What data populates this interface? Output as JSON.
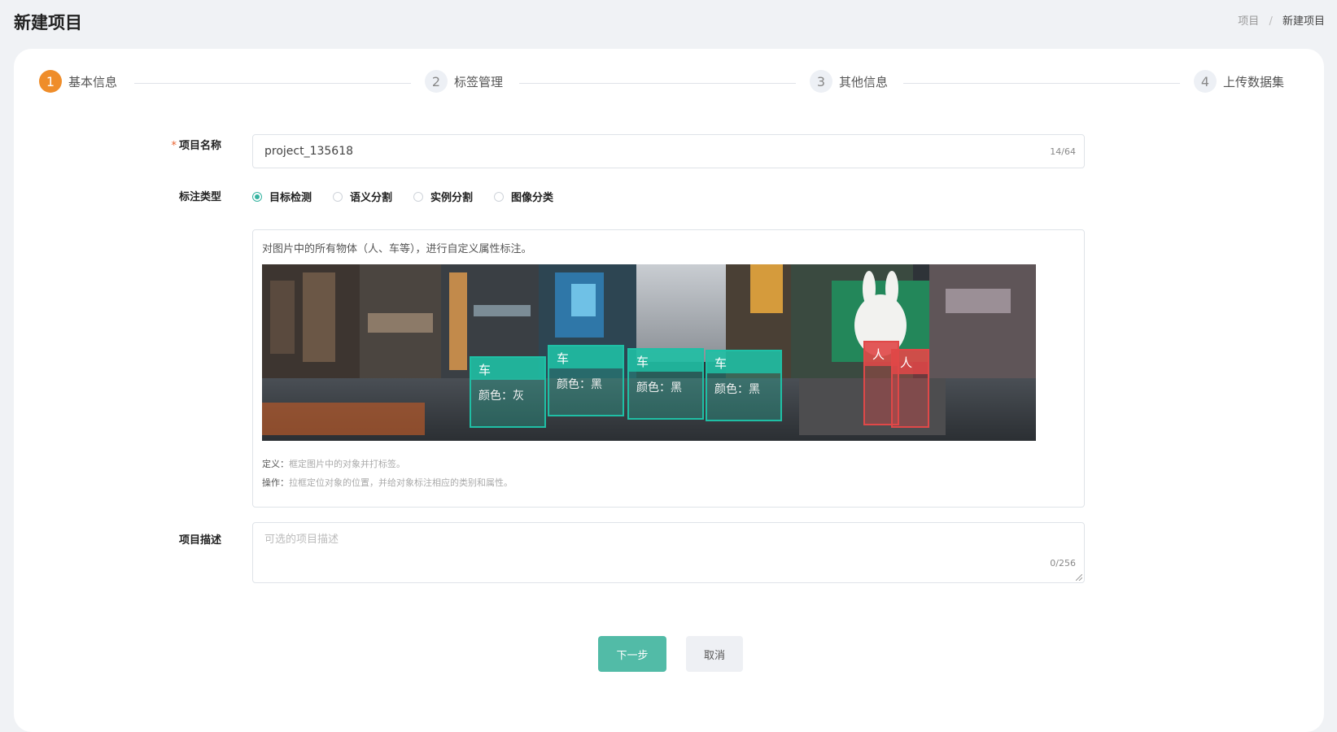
{
  "header": {
    "title": "新建项目",
    "breadcrumb": {
      "parent": "项目",
      "separator": "/",
      "current": "新建项目"
    }
  },
  "steps": [
    {
      "number": "1",
      "label": "基本信息",
      "active": true
    },
    {
      "number": "2",
      "label": "标签管理",
      "active": false
    },
    {
      "number": "3",
      "label": "其他信息",
      "active": false
    },
    {
      "number": "4",
      "label": "上传数据集",
      "active": false
    }
  ],
  "form": {
    "name": {
      "required_mark": "*",
      "label": "项目名称",
      "value": "project_135618",
      "counter": "14/64"
    },
    "annotation_type": {
      "label": "标注类型",
      "options": [
        {
          "label": "目标检测",
          "checked": true
        },
        {
          "label": "语义分割",
          "checked": false
        },
        {
          "label": "实例分割",
          "checked": false
        },
        {
          "label": "图像分类",
          "checked": false
        }
      ]
    },
    "type_description": {
      "intro": "对图片中的所有物体（人、车等），进行自定义属性标注。",
      "image_boxes": [
        {
          "label": "车",
          "attr": "颜色：灰"
        },
        {
          "label": "车",
          "attr": "颜色：黑"
        },
        {
          "label": "车",
          "attr": "颜色：黑"
        },
        {
          "label": "车",
          "attr": "颜色：黑"
        },
        {
          "label": "人"
        },
        {
          "label": "人"
        }
      ],
      "definition_label": "定义：",
      "definition_text": "框定图片中的对象并打标签。",
      "operation_label": "操作：",
      "operation_text": "拉框定位对象的位置，并给对象标注相应的类别和属性。"
    },
    "description": {
      "label": "项目描述",
      "placeholder": "可选的项目描述",
      "counter": "0/256"
    }
  },
  "buttons": {
    "next": "下一步",
    "cancel": "取消"
  },
  "colors": {
    "accent": "#52bba7",
    "step_active": "#ef8d2a",
    "required": "#e8612e",
    "box_car": "#1fbfa5",
    "box_person": "#e04848"
  }
}
